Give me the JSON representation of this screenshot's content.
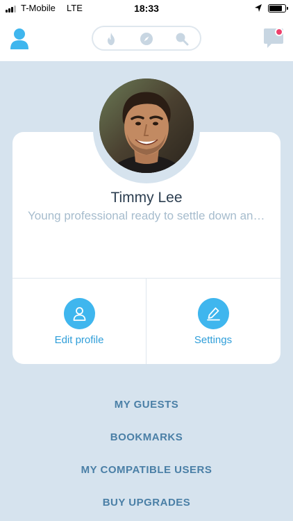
{
  "status_bar": {
    "carrier": "T-Mobile",
    "network": "LTE",
    "time": "18:33",
    "battery_level": 0.85
  },
  "header": {
    "left_icon": "user-profile-icon",
    "segments": [
      {
        "icon": "fire-icon"
      },
      {
        "icon": "compass-icon"
      },
      {
        "icon": "search-icon"
      }
    ],
    "right_icon": "chat-icon",
    "accent_color": "#3fb6ee",
    "notification_color": "#ee3f6b"
  },
  "profile": {
    "name": "Timmy Lee",
    "bio": "Young professional ready to settle down and start a family"
  },
  "actions": {
    "edit_label": "Edit profile",
    "edit_icon": "person-outline-icon",
    "settings_label": "Settings",
    "settings_icon": "pencil-icon"
  },
  "menu": {
    "items": [
      {
        "label": "MY GUESTS"
      },
      {
        "label": "BOOKMARKS"
      },
      {
        "label": "MY COMPATIBLE USERS"
      },
      {
        "label": "BUY UPGRADES"
      }
    ]
  }
}
